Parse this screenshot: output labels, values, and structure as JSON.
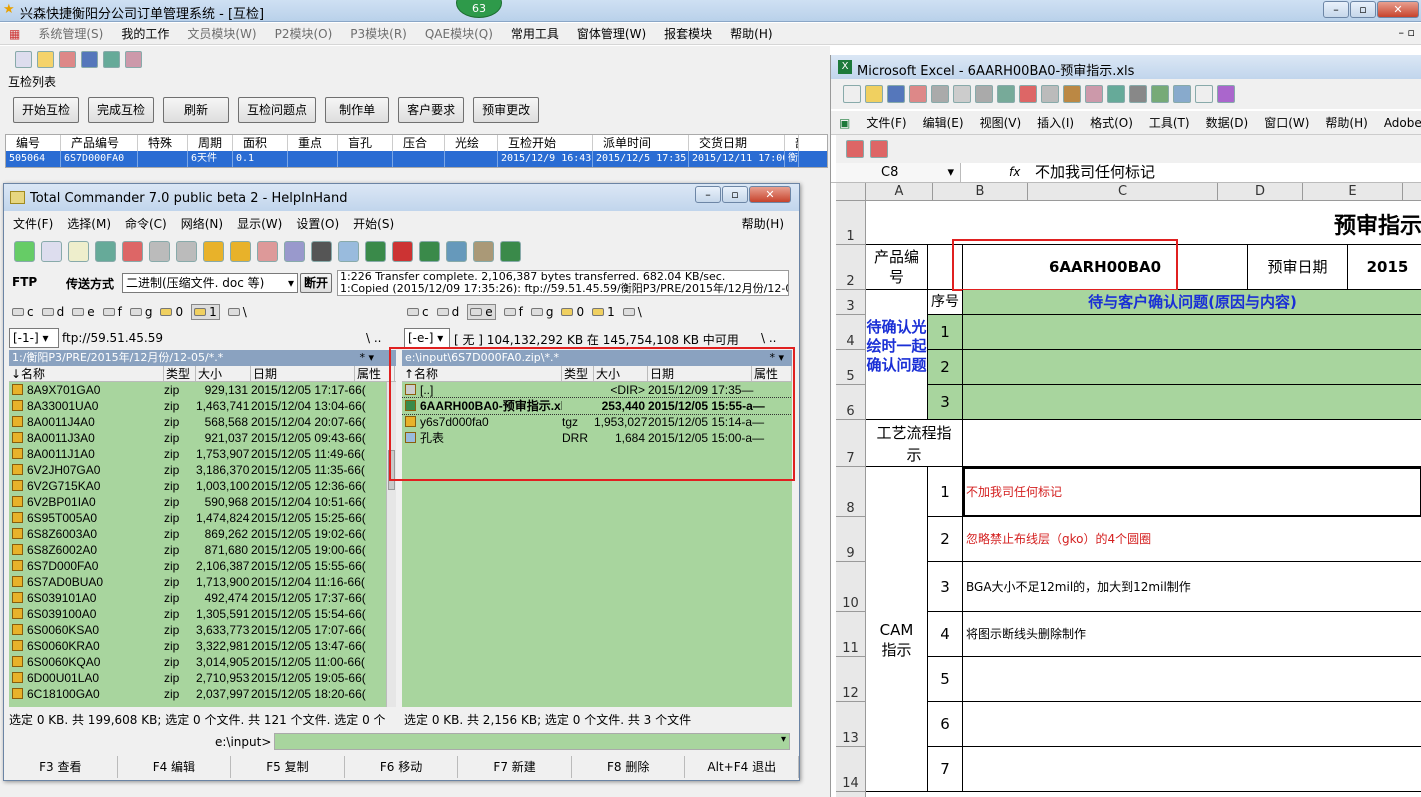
{
  "app": {
    "title": "兴森快捷衡阳分公司订单管理系统 - [互检]",
    "badge": "63",
    "menu": [
      "系统管理(S)",
      "我的工作",
      "文员模块(W)",
      "P2模块(O)",
      "P3模块(R)",
      "QAE模块(Q)",
      "常用工具",
      "窗体管理(W)",
      "报套模块",
      "帮助(H)"
    ],
    "section_label": "互检列表",
    "buttons": [
      "开始互检",
      "完成互检",
      "刷新",
      "互检问题点",
      "制作单",
      "客户要求",
      "预审更改"
    ],
    "grid": {
      "columns": [
        "编号",
        "产品编号",
        "特殊",
        "周期",
        "面积",
        "重点",
        "盲孔",
        "压合",
        "光绘",
        "互检开始",
        "派单时间",
        "交货日期",
        "部"
      ],
      "row": [
        "505064",
        "6S7D000FA0",
        "",
        "6天件",
        "0.1",
        "",
        "",
        "",
        "",
        "2015/12/9 16:43",
        "2015/12/5 17:35",
        "2015/12/11 17:00",
        "衡"
      ]
    }
  },
  "tc": {
    "title": "Total Commander 7.0 public beta 2 - HelpInHand",
    "menu": [
      "文件(F)",
      "选择(M)",
      "命令(C)",
      "网络(N)",
      "显示(W)",
      "设置(O)",
      "开始(S)"
    ],
    "help": "帮助(H)",
    "ftp_label": "FTP",
    "transfer_label": "传送方式",
    "transfer_mode": "二进制(压缩文件. doc 等)",
    "disconnect": "断开",
    "log1": "1:226 Transfer complete. 2,106,387 bytes transferred. 682.04 KB/sec.",
    "log2": "1:Copied (2015/12/09 17:35:26): ftp://59.51.45.59/衡阳P3/PRE/2015年/12月份/12-05/",
    "drives_left": [
      "c",
      "d",
      "e",
      "f",
      "g",
      "0",
      "1",
      "\\"
    ],
    "drives_right": [
      "c",
      "d",
      "e",
      "f",
      "g",
      "0",
      "1",
      "\\"
    ],
    "left_drive": "[-1-]",
    "left_addr": "ftp://59.51.45.59",
    "right_drive": "[-e-]",
    "right_info": "[ 无 ]  104,132,292 KB 在 145,754,108 KB 中可用",
    "left_path": "1:/衡阳P3/PRE/2015年/12月份/12-05/*.*",
    "right_path": "e:\\input\\6S7D000FA0.zip\\*.*",
    "col_headers": [
      "↓名称",
      "类型",
      "大小",
      "日期",
      "属性"
    ],
    "right_col_headers": [
      "↑名称",
      "类型",
      "大小",
      "日期",
      "属性"
    ],
    "left_files": [
      [
        "8A9X701GA0",
        "zip",
        "929,131",
        "2015/12/05 17:17-66("
      ],
      [
        "8A33001UA0",
        "zip",
        "1,463,741",
        "2015/12/04 13:04-66("
      ],
      [
        "8A0011J4A0",
        "zip",
        "568,568",
        "2015/12/04 20:07-66("
      ],
      [
        "8A0011J3A0",
        "zip",
        "921,037",
        "2015/12/05 09:43-66("
      ],
      [
        "8A0011J1A0",
        "zip",
        "1,753,907",
        "2015/12/05 11:49-66("
      ],
      [
        "6V2JH07GA0",
        "zip",
        "3,186,370",
        "2015/12/05 11:35-66("
      ],
      [
        "6V2G715KA0",
        "zip",
        "1,003,100",
        "2015/12/05 12:36-66("
      ],
      [
        "6V2BP01IA0",
        "zip",
        "590,968",
        "2015/12/04 10:51-66("
      ],
      [
        "6S95T005A0",
        "zip",
        "1,474,824",
        "2015/12/05 15:25-66("
      ],
      [
        "6S8Z6003A0",
        "zip",
        "869,262",
        "2015/12/05 19:02-66("
      ],
      [
        "6S8Z6002A0",
        "zip",
        "871,680",
        "2015/12/05 19:00-66("
      ],
      [
        "6S7D000FA0",
        "zip",
        "2,106,387",
        "2015/12/05 15:55-66("
      ],
      [
        "6S7AD0BUA0",
        "zip",
        "1,713,900",
        "2015/12/04 11:16-66("
      ],
      [
        "6S039101A0",
        "zip",
        "492,474",
        "2015/12/05 17:37-66("
      ],
      [
        "6S039100A0",
        "zip",
        "1,305,591",
        "2015/12/05 15:54-66("
      ],
      [
        "6S0060KSA0",
        "zip",
        "3,633,773",
        "2015/12/05 17:07-66("
      ],
      [
        "6S0060KRA0",
        "zip",
        "3,322,981",
        "2015/12/05 13:47-66("
      ],
      [
        "6S0060KQA0",
        "zip",
        "3,014,905",
        "2015/12/05 11:00-66("
      ],
      [
        "6D00U01LA0",
        "zip",
        "2,710,953",
        "2015/12/05 19:05-66("
      ],
      [
        "6C18100GA0",
        "zip",
        "2,037,997",
        "2015/12/05 18:20-66("
      ]
    ],
    "right_files": [
      [
        "[..]",
        "",
        "<DIR>",
        "2015/12/09 17:35—"
      ],
      [
        "6AARH00BA0-预审指示.xls",
        "",
        "253,440",
        "2015/12/05 15:55-a—"
      ],
      [
        "y6s7d000fa0",
        "tgz",
        "1,953,027",
        "2015/12/05 15:14-a—"
      ],
      [
        "孔表",
        "DRR",
        "1,684",
        "2015/12/05 15:00-a—"
      ]
    ],
    "status_left": "选定 0 KB. 共 199,608 KB; 选定 0 个文件. 共 121 个文件. 选定 0 个",
    "status_right": "选定 0 KB. 共 2,156 KB; 选定 0 个文件. 共 3 个文件",
    "cmd_path": "e:\\input>",
    "fkeys": [
      "F3 查看",
      "F4 编辑",
      "F5 复制",
      "F6 移动",
      "F7 新建",
      "F8 删除",
      "Alt+F4 退出"
    ]
  },
  "excel": {
    "title": "Microsoft Excel - 6AARH00BA0-预审指示.xls",
    "menu": [
      "文件(F)",
      "编辑(E)",
      "视图(V)",
      "插入(I)",
      "格式(O)",
      "工具(T)",
      "数据(D)",
      "窗口(W)",
      "帮助(H)",
      "Adobe F"
    ],
    "name_box": "C8",
    "fx": "fx",
    "formula": "不加我司任何标记",
    "cols": [
      "A",
      "B",
      "C",
      "D",
      "E",
      "F"
    ],
    "rows": [
      "1",
      "2",
      "3",
      "4",
      "5",
      "6",
      "7",
      "8",
      "9",
      "10",
      "11",
      "12",
      "13",
      "14",
      "8"
    ],
    "sheet_title": "预审指示",
    "product_label": "产品编号",
    "product_value": "6AARH00BA0",
    "pre_date_label": "预审日期",
    "pre_date_value": "2015",
    "seq_label": "序号",
    "confirm_header": "待与客户确认问题(原因与内容)",
    "confirm_label": "待确认光绘时一起确认问题",
    "confirm_nums": [
      "1",
      "2",
      "3"
    ],
    "process_label": "工艺流程指示",
    "cam_label": "CAM指示",
    "cam_nums": [
      "1",
      "2",
      "3",
      "4",
      "5",
      "6",
      "7"
    ],
    "cam_items": [
      "不加我司任何标记",
      "忽略禁止布线层（gko）的4个圆圈",
      "BGA大小不足12mil的，加大到12mil制作",
      "将图示断线头删除制作",
      "",
      "",
      ""
    ]
  }
}
